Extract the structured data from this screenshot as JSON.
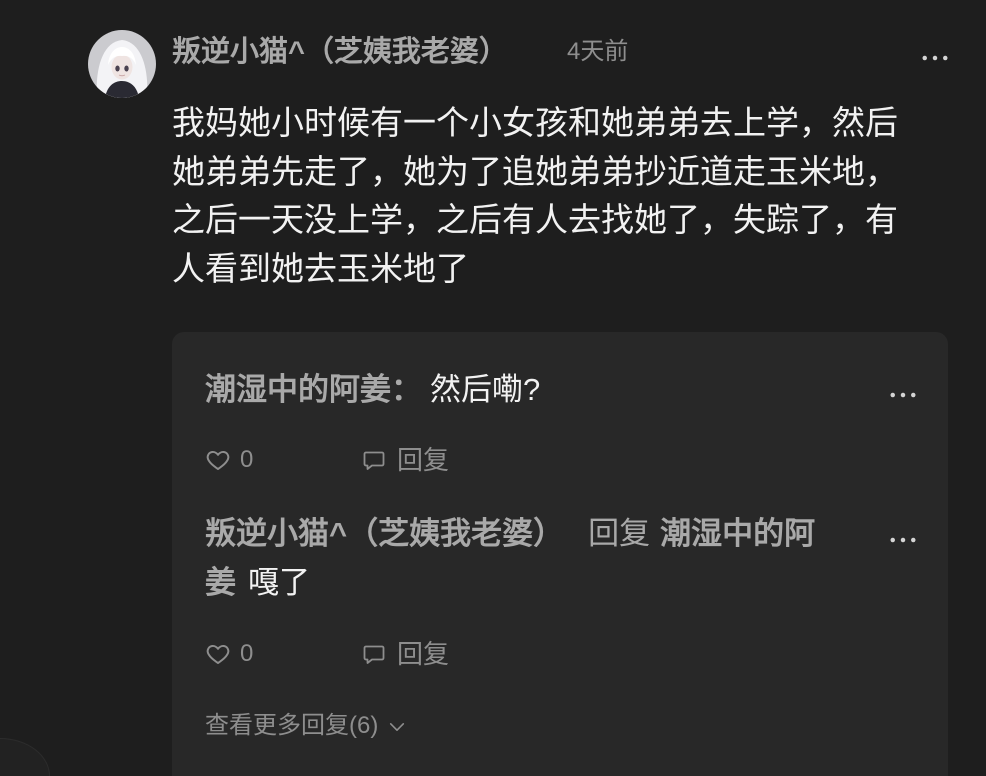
{
  "theme": {
    "page_bg": "#1e1e1e",
    "card_bg": "#282828",
    "name_color": "#a9a9a9",
    "text_color": "#f2f2f2",
    "meta_color": "#8e8e8e",
    "icon_color": "#d4d4d4"
  },
  "comment": {
    "avatar_icon": "avatar-anime-girl",
    "author": "叛逆小猫^（芝姨我老婆）",
    "time": "4天前",
    "more_icon": "more-horizontal-icon",
    "text_lines": [
      "我妈她小时候有一个小女孩和她弟弟去上学，然后",
      "她弟弟先走了，她为了追她弟弟抄近道走玉米地，",
      "之后一天没上学，之后有人去找她了，失踪了，有",
      "人看到她去玉米地了"
    ]
  },
  "replies": [
    {
      "author": "潮湿中的阿姜",
      "separator": "：",
      "text": "然后嘞?",
      "like_icon": "heart-icon",
      "likes": 0,
      "reply_icon": "comment-icon",
      "reply_label": "回复"
    },
    {
      "author": "叛逆小猫^（芝姨我老婆）",
      "reply_to_label": "回复",
      "reply_to": "潮湿中的阿姜",
      "text": "嘎了",
      "like_icon": "heart-icon",
      "likes": 0,
      "reply_icon": "comment-icon",
      "reply_label": "回复"
    }
  ],
  "view_more": {
    "label": "查看更多回复(6)",
    "icon": "chevron-down-icon"
  }
}
